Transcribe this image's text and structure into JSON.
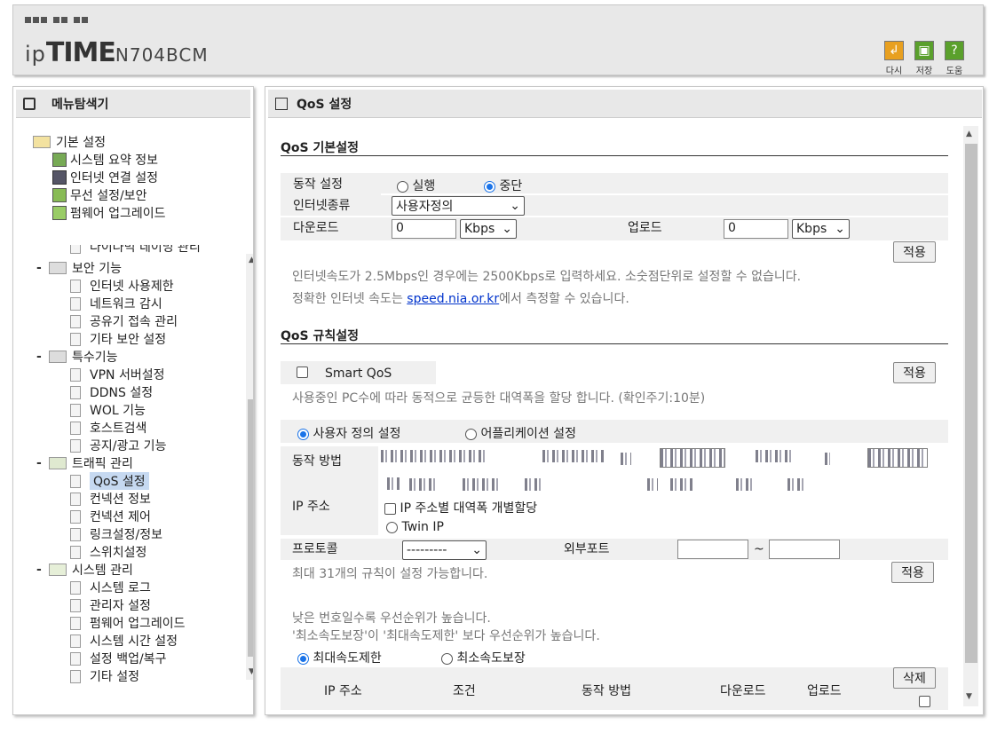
{
  "header": {
    "brand_ip": "ip",
    "brand_time": "TIME",
    "brand_model": "N704BCM",
    "buttons": [
      {
        "label": "다시",
        "icon": "undo-icon",
        "color": "#e8a020"
      },
      {
        "label": "저장",
        "icon": "save-icon",
        "color": "#5aa02c"
      },
      {
        "label": "도움",
        "icon": "help-icon",
        "color": "#5aa02c"
      }
    ]
  },
  "menu": {
    "title": "메뉴탐색기",
    "basic": {
      "label": "기본 설정",
      "items": [
        "시스템 요약 정보",
        "인터넷 연결 설정",
        "무선 설정/보안",
        "펌웨어 업그레이드"
      ]
    },
    "partial_item": "다이나믹 네이밍 관리",
    "security": {
      "label": "보안 기능",
      "items": [
        "인터넷 사용제한",
        "네트워크 감시",
        "공유기 접속 관리",
        "기타 보안 설정"
      ]
    },
    "special": {
      "label": "특수기능",
      "items": [
        "VPN 서버설정",
        "DDNS 설정",
        "WOL 기능",
        "호스트검색",
        "공지/광고 기능"
      ]
    },
    "traffic": {
      "label": "트래픽 관리",
      "items": [
        "QoS 설정",
        "컨넥션 정보",
        "컨넥션 제어",
        "링크설정/정보",
        "스위치설정"
      ]
    },
    "system": {
      "label": "시스템 관리",
      "items": [
        "시스템 로그",
        "관리자 설정",
        "펌웨어 업그레이드",
        "시스템 시간 설정",
        "설정 백업/복구",
        "기타 설정"
      ]
    },
    "selected": "QoS 설정"
  },
  "qos": {
    "title": "QoS 설정",
    "basic_title": "QoS 기본설정",
    "op_label": "동작 설정",
    "op_on": "실행",
    "op_off": "중단",
    "op_selected": "중단",
    "inet_type_label": "인터넷종류",
    "inet_type_value": "사용자정의",
    "download_label": "다운로드",
    "download_value": "0",
    "download_unit": "Kbps",
    "upload_label": "업로드",
    "upload_value": "0",
    "upload_unit": "Kbps",
    "apply": "적용",
    "hint1": "인터넷속도가 2.5Mbps인 경우에는 2500Kbps로 입력하세요. 소숫점단위로 설정할 수 없습니다.",
    "hint2_pre": "정확한 인터넷 속도는 ",
    "hint2_link": "speed.nia.or.kr",
    "hint2_post": "에서 측정할 수 있습니다.",
    "rule_title": "QoS 규칙설정",
    "smart_qos": "Smart QoS",
    "smart_hint": "사용중인 PC수에 따라 동적으로 균등한 대역폭을 할당 합니다. (확인주기:10분)",
    "mode_user": "사용자 정의 설정",
    "mode_app": "어플리케이션 설정",
    "action_label": "동작 방법",
    "ip_label": "IP 주소",
    "ip_per_bandwidth": "IP 주소별 대역폭 개별할당",
    "twin_ip": "Twin IP",
    "protocol_label": "프로토콜",
    "protocol_value": "---------",
    "ext_port_label": "외부포트",
    "port_sep": "~",
    "max_rules": "최대 31개의 규칙이 설정 가능합니다.",
    "prio1": "낮은 번호일수록 우선순위가 높습니다.",
    "prio2": "'최소속도보장'이 '최대속도제한' 보다 우선순위가 높습니다.",
    "limit_max": "최대속도제한",
    "limit_min": "최소속도보장",
    "cols": [
      "IP 주소",
      "조건",
      "동작 방법",
      "다운로드",
      "업로드"
    ],
    "delete": "삭제"
  }
}
